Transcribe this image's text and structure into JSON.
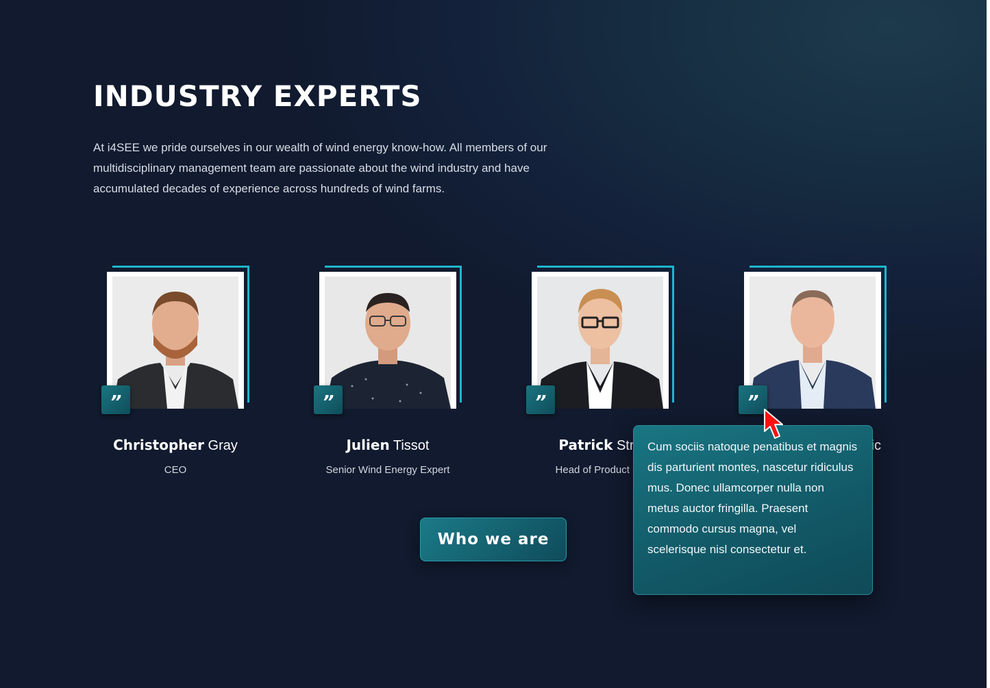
{
  "section": {
    "title": "INDUSTRY EXPERTS",
    "intro": "At i4SEE we pride ourselves in our wealth of wind energy know-how. All members of our multidisciplinary management team are passionate about the wind industry and have accumulated decades of experience across hundreds of wind farms."
  },
  "experts": [
    {
      "first": "Christopher",
      "last": "Gray",
      "role": "CEO",
      "quote_icon": "quote-icon"
    },
    {
      "first": "Julien",
      "last": "Tissot",
      "role": "Senior Wind Energy Expert",
      "quote_icon": "quote-icon"
    },
    {
      "first": "Patrick",
      "last": "Stro",
      "role": "Head of Product Su",
      "quote_icon": "quote-icon"
    },
    {
      "first": "",
      "last": "vic",
      "role": "",
      "quote_icon": "quote-icon"
    }
  ],
  "quote_glyph": "”",
  "cta": {
    "label": "Who we are"
  },
  "tooltip": {
    "text": "Cum sociis natoque penatibus et magnis dis parturient montes, nascetur ridiculus mus. Donec ullamcorper nulla non metus auctor fringilla. Praesent commodo cursus magna, vel scelerisque nisl consectetur et."
  },
  "colors": {
    "accent": "#1eb6cc",
    "badge": "#16636f",
    "background": "#111a2e",
    "cursor": "#ff0000"
  }
}
